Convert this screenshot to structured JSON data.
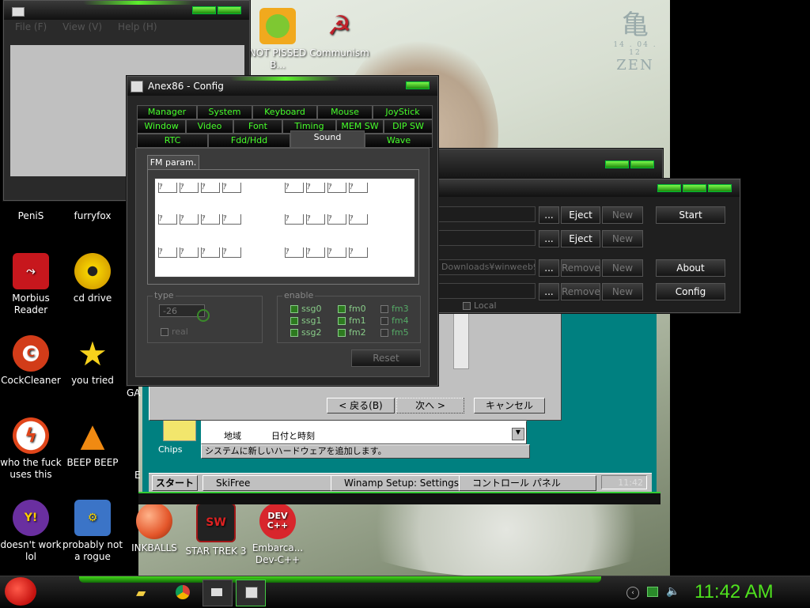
{
  "desktop": {
    "icons": [
      {
        "label": "PeniS",
        "icon": "penis-icon"
      },
      {
        "label": "furryfox",
        "icon": "firefox-icon"
      },
      {
        "label": "Morbius Reader",
        "icon": "pdf-reader-icon",
        "color": "#c7171d"
      },
      {
        "label": "cd drive",
        "icon": "cd-icon",
        "color": "#e2b000"
      },
      {
        "label": "CockCleaner",
        "icon": "ccleaner-icon",
        "color": "#d23c19"
      },
      {
        "label": "you tried",
        "icon": "star-icon",
        "color": "#f7d21c"
      },
      {
        "label": "who the fuck uses this",
        "icon": "flash-icon",
        "color": "#e0451a"
      },
      {
        "label": "BEEP BEEP",
        "icon": "vlc-cone-icon",
        "color": "#f08a12"
      },
      {
        "label": "doesn't work lol",
        "icon": "yahoo-messenger-icon",
        "color": "#6a2fa0"
      },
      {
        "label": "probably not a rogue",
        "icon": "gear-monitor-icon",
        "color": "#3b74c7"
      },
      {
        "label": "INKBALLS",
        "icon": "inkball-icon",
        "color": "#e4562a"
      },
      {
        "label": "STAR TREK 3",
        "icon": "star-wars-icon",
        "color": "#a21616"
      },
      {
        "label": "Embarca... Dev-C++",
        "icon": "devcpp-icon",
        "color": "#d8262c"
      },
      {
        "label": "NOT PISSED B...",
        "icon": "bad-piggies-icon",
        "color": "#f1a91e"
      },
      {
        "label": "Communism",
        "icon": "hammer-sickle-icon",
        "color": "#c0212b"
      },
      {
        "label": "GA",
        "icon": "partial-icon"
      },
      {
        "label": "E",
        "icon": "partial-icon"
      }
    ],
    "wallpaper_text": {
      "kanji": "亀",
      "date": "14 . 04 . 12",
      "zen": "ZEN"
    }
  },
  "explorer_window": {
    "menu": [
      "File (F)",
      "View (V)",
      "Help (H)"
    ]
  },
  "config_window": {
    "title": "Anex86 - Config",
    "tab_rows": [
      [
        "Manager",
        "System",
        "Keyboard",
        "Mouse",
        "JoyStick"
      ],
      [
        "Window",
        "Video",
        "Font",
        "Timing",
        "MEM SW",
        "DIP SW"
      ],
      [
        "RTC",
        "Fdd/Hdd",
        "Sound",
        "Wave"
      ]
    ],
    "selected_tab": "Sound",
    "subtab": "FM param.",
    "fm_label": "ｱ",
    "type_group": {
      "label": "type",
      "value": "-26",
      "real_label": "real"
    },
    "enable_group": {
      "label": "enable",
      "items": [
        {
          "label": "ssg0",
          "on": true
        },
        {
          "label": "fm0",
          "on": true
        },
        {
          "label": "fm3",
          "on": false
        },
        {
          "label": "ssg1",
          "on": true
        },
        {
          "label": "fm1",
          "on": true
        },
        {
          "label": "fm4",
          "on": false
        },
        {
          "label": "ssg2",
          "on": true
        },
        {
          "label": "fm2",
          "on": true
        },
        {
          "label": "fm5",
          "on": false
        }
      ]
    },
    "reset_label": "Reset"
  },
  "anex_main": {
    "rows": [
      {
        "path": "",
        "btn1": "Eject",
        "btn2": "New",
        "side": "Start"
      },
      {
        "path": "",
        "btn1": "Eject",
        "btn2": "New",
        "side": ""
      },
      {
        "path": "Downloads¥winweeb9",
        "btn1": "Remove",
        "btn2": "New",
        "side": "About"
      },
      {
        "path": "",
        "btn1": "Remove",
        "btn2": "New",
        "side": "Config"
      }
    ],
    "browse": "...",
    "local_label": "Local"
  },
  "win98": {
    "back": "< 戻る(B)",
    "next": "次へ >",
    "cancel": "キャンセル",
    "list_items": [
      "地域",
      "日付と時刻"
    ],
    "status": "システムに新しいハードウェアを追加します。",
    "chips_label": "Chips",
    "taskbar": {
      "start": "スタート",
      "items": [
        "SkiFree",
        "Winamp Setup: Settings",
        "コントロール パネル"
      ],
      "clock": "11:42"
    }
  },
  "taskbar": {
    "clock": "11:42 AM",
    "accent": "#4fe21e"
  }
}
